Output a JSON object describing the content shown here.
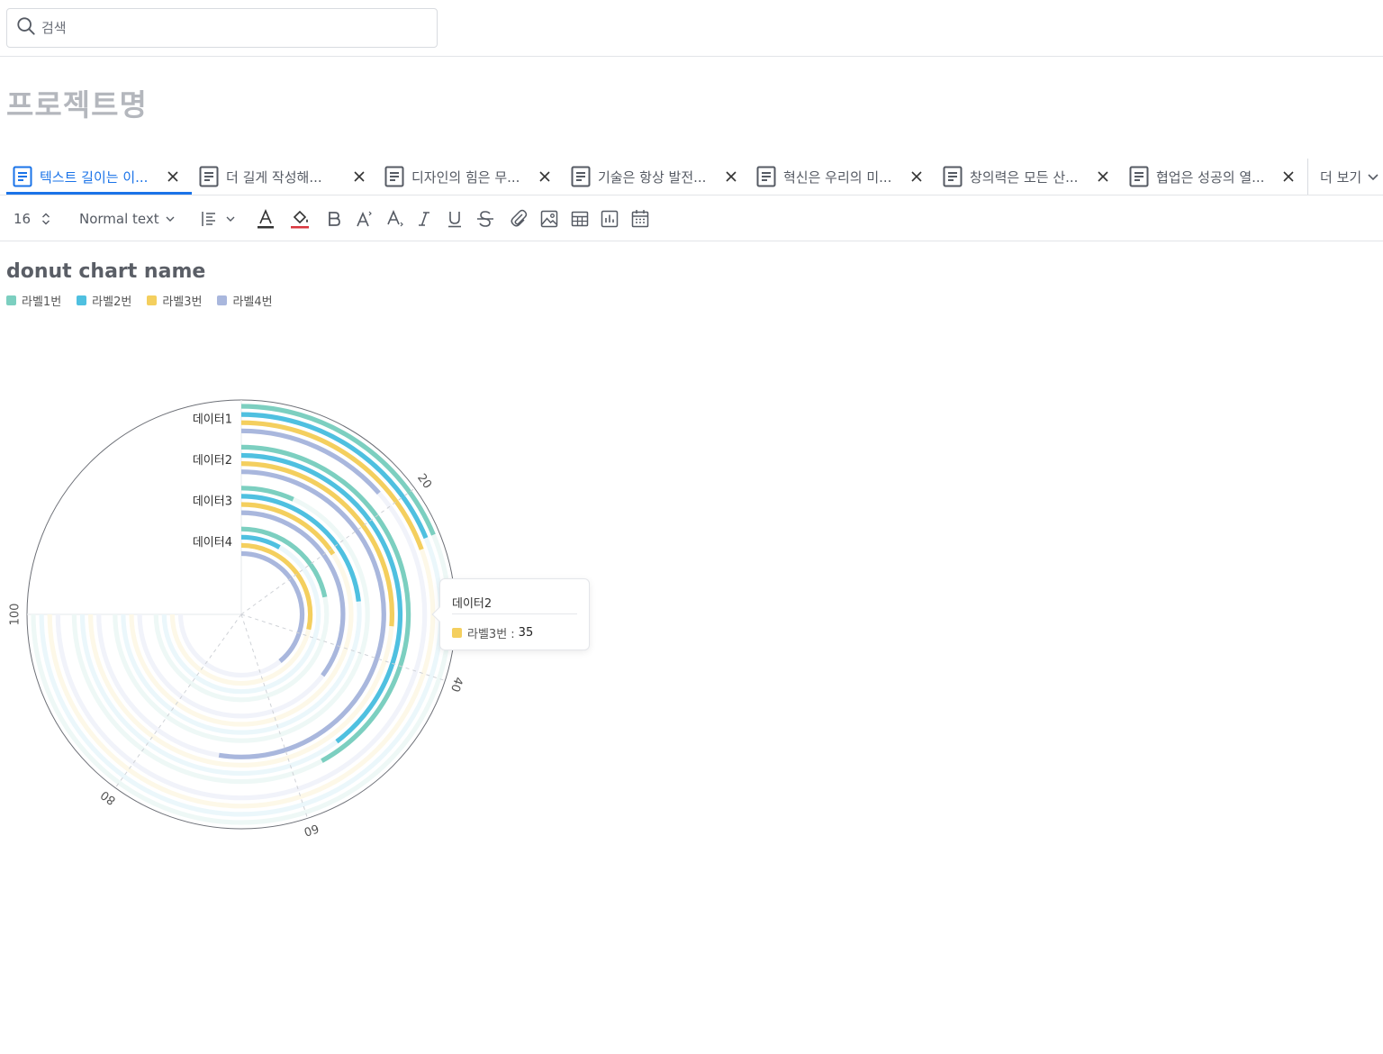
{
  "search": {
    "placeholder": "검색"
  },
  "project": {
    "title": "프로젝트명"
  },
  "tabs": [
    {
      "label": "텍스트 길이는 이...",
      "active": true
    },
    {
      "label": "더 길게 작성해..."
    },
    {
      "label": "디자인의 힘은 무..."
    },
    {
      "label": "기술은 항상 발전..."
    },
    {
      "label": "혁신은 우리의 미..."
    },
    {
      "label": "창의력은 모든 산..."
    },
    {
      "label": "협업은 성공의 열..."
    }
  ],
  "more_tabs": {
    "label": "더 보기"
  },
  "toolbar": {
    "font_size": "16",
    "text_style": "Normal text",
    "text_style_options": [
      "Normal text"
    ]
  },
  "colors": {
    "accent": "#1a73e8",
    "series1": "#7ccfc0",
    "series2": "#4fc0e0",
    "series3": "#f4cf5e",
    "series4": "#a9b7dd",
    "text_color_bar": "#333333",
    "highlight_bar": "#d9363e"
  },
  "chart_data": {
    "type": "radial-bar",
    "title": "donut chart name",
    "angle_axis": {
      "min": 0,
      "max": 100,
      "ticks": [
        "20",
        "40",
        "60",
        "80",
        "100"
      ]
    },
    "categories": [
      "데이터1",
      "데이터2",
      "데이터3",
      "데이터4"
    ],
    "series": [
      {
        "name": "라벨1번",
        "values": [
          25,
          56,
          9,
          29
        ]
      },
      {
        "name": "라벨2번",
        "values": [
          25,
          53,
          31,
          11
        ]
      },
      {
        "name": "라벨3번",
        "values": [
          26,
          35,
          21,
          38
        ]
      },
      {
        "name": "라벨4번",
        "values": [
          18,
          70,
          47,
          52
        ]
      }
    ],
    "legend": "top-left",
    "tooltip": {
      "category": "데이터2",
      "series": "라벨3번",
      "label": "라벨3번 :",
      "value": "35"
    }
  }
}
